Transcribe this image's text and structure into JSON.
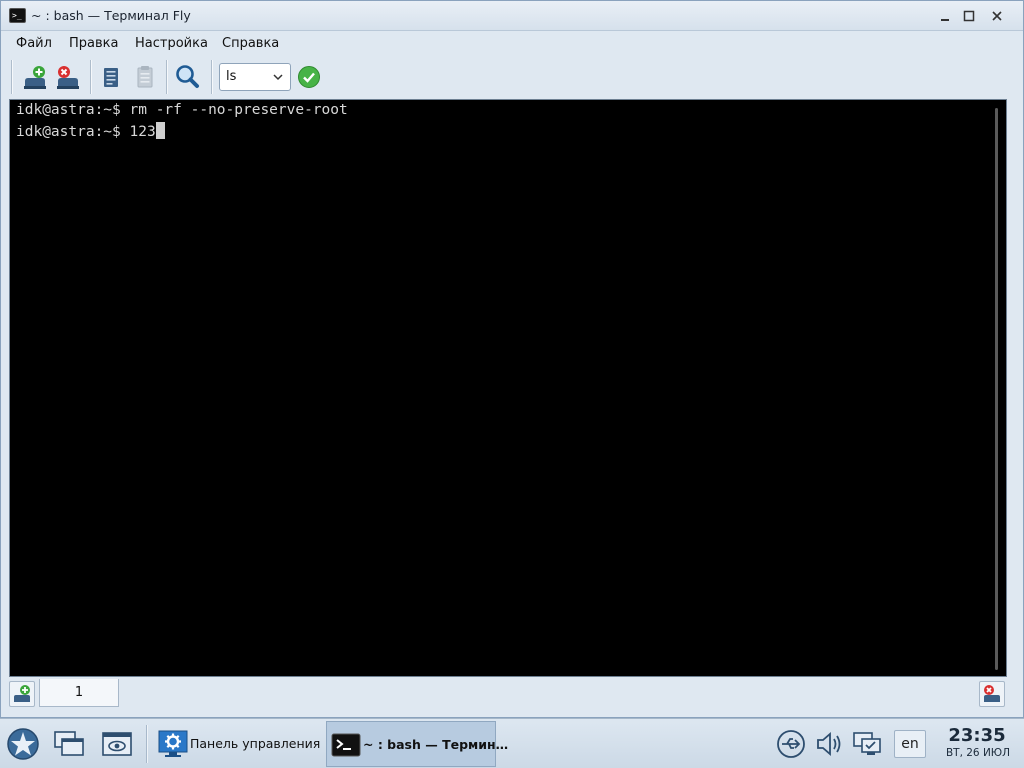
{
  "window": {
    "title": "~ : bash — Терминал Fly",
    "icon": "terminal-icon",
    "controls": [
      "minimize-icon",
      "maximize-icon",
      "close-icon"
    ]
  },
  "menu": {
    "items": [
      {
        "label": "Файл"
      },
      {
        "label": "Правка"
      },
      {
        "label": "Настройка"
      },
      {
        "label": "Справка"
      }
    ]
  },
  "toolbar": {
    "buttons": [
      "new-session-icon",
      "close-session-icon",
      "copy-icon",
      "paste-icon",
      "search-icon"
    ],
    "command_select": {
      "value": "ls"
    },
    "run_icon": "run-check-icon"
  },
  "terminal": {
    "lines": [
      {
        "prompt": "idk@astra:~$ ",
        "text": "rm -rf --no-preserve-root"
      },
      {
        "prompt": "idk@astra:~$ ",
        "text": "123"
      }
    ],
    "background": "#000000",
    "foreground": "#d8d8d8"
  },
  "tabs": {
    "items": [
      {
        "label": "1"
      }
    ],
    "add_icon": "new-tab-icon",
    "close_icon": "close-tab-icon"
  },
  "taskbar": {
    "launchers": [
      "start-menu-icon",
      "desktops-icon",
      "show-desktop-icon"
    ],
    "tasks": [
      {
        "label": "Панель управления",
        "icon": "control-panel-icon",
        "active": false
      },
      {
        "label": "~ : bash — Термин…",
        "icon": "terminal-icon",
        "active": true
      }
    ],
    "tray": [
      "usb-icon",
      "volume-icon",
      "network-icon"
    ],
    "language": "en",
    "clock": {
      "time": "23:35",
      "date": "ВТ, 26 ИЮЛ"
    }
  }
}
